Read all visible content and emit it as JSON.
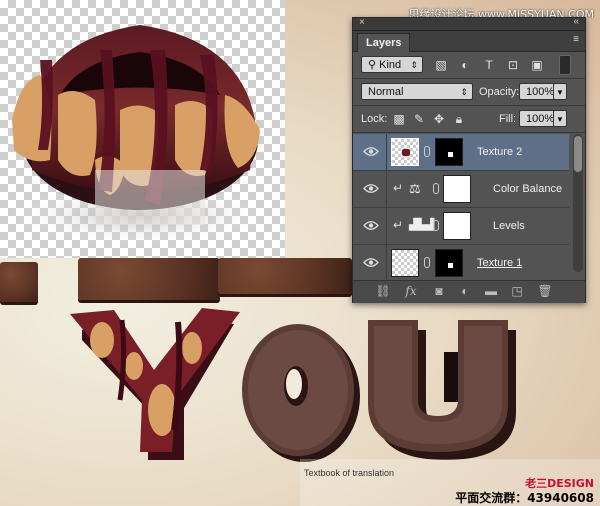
{
  "watermark": "思缘设计论坛 www.MISSYUAN.COM",
  "layers_panel": {
    "title": "Layers",
    "close": "×",
    "collapse": "«",
    "menu": "≡",
    "filter_kind": "Kind",
    "blend_mode": "Normal",
    "opacity_label": "Opacity:",
    "opacity_value": "100%",
    "lock_label": "Lock:",
    "fill_label": "Fill:",
    "fill_value": "100%",
    "layers": [
      {
        "name": "Texture 2",
        "selected": true
      },
      {
        "name": "Color Balance",
        "selected": false
      },
      {
        "name": "Levels",
        "selected": false
      },
      {
        "name": "Texture 1",
        "selected": false
      }
    ],
    "footer_icons": [
      "link-icon",
      "fx-icon",
      "mask-icon",
      "adjustment-icon",
      "folder-icon",
      "new-layer-icon",
      "trash-icon"
    ],
    "fx_label": "fx"
  },
  "canvas": {
    "word": "YOU"
  },
  "caption": "Textbook of translation",
  "brand": "老三DESIGN",
  "qq_group": "平面交流群：43940608"
}
